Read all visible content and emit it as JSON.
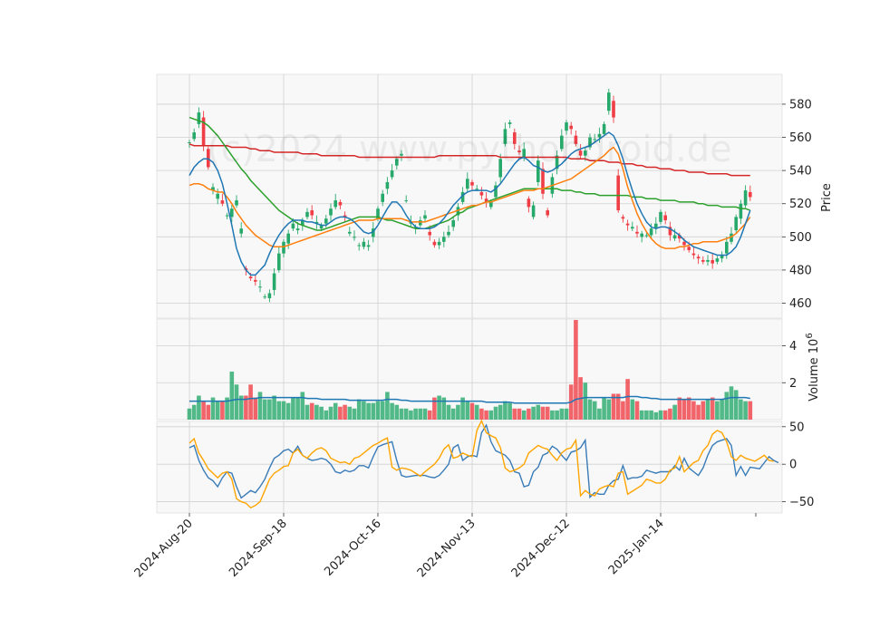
{
  "chart_data": {
    "type": "candlestick",
    "watermark": "(c)2024 www.pythondroid.de",
    "x_ticks": [
      "2024-Aug-20",
      "2024-Sep-18",
      "2024-Oct-16",
      "2024-Nov-13",
      "2024-Dec-12",
      "2025-Jan-14"
    ],
    "x_tick_index": [
      0,
      20,
      40,
      60,
      80,
      100
    ],
    "n_bars": 120,
    "colors": {
      "up": "#26a96a",
      "down": "#ef3e45",
      "ma_short": "#1f77b4",
      "ma_mid": "#ff7f0e",
      "ma_long": "#2ca02c",
      "ma_200": "#d62728",
      "osc_1": "#3a7cb8",
      "osc_2": "#ffa500"
    },
    "price_panel": {
      "ylabel": "Price",
      "yticks": [
        460,
        480,
        500,
        520,
        540,
        560,
        580
      ],
      "ylim": [
        451,
        598
      ],
      "close": [
        557,
        563,
        575,
        555,
        542,
        530,
        526,
        520,
        513,
        517,
        522,
        505,
        480,
        475,
        473,
        470,
        464,
        466,
        478,
        490,
        497,
        502,
        508,
        505,
        510,
        515,
        513,
        509,
        507,
        511,
        517,
        522,
        519,
        512,
        503,
        500,
        495,
        497,
        495,
        505,
        517,
        526,
        533,
        540,
        547,
        550,
        522,
        509,
        506,
        510,
        513,
        501,
        495,
        497,
        500,
        503,
        510,
        518,
        527,
        535,
        531,
        529,
        525,
        521,
        521,
        531,
        547,
        565,
        569,
        556,
        551,
        553,
        518,
        519,
        546,
        526,
        513,
        536,
        549,
        561,
        569,
        565,
        556,
        549,
        552,
        560,
        559,
        562,
        568,
        587,
        572,
        516,
        511,
        507,
        506,
        502,
        502,
        501,
        505,
        508,
        515,
        510,
        501,
        501,
        499,
        495,
        492,
        489,
        487,
        485,
        486,
        484,
        487,
        489,
        497,
        502,
        512,
        520,
        528,
        524
      ],
      "open": [
        557,
        559,
        568,
        572,
        553,
        528,
        523,
        522,
        513,
        512,
        519,
        502,
        481,
        476,
        474,
        470,
        464,
        463,
        468,
        480,
        490,
        496,
        505,
        504,
        507,
        512,
        516,
        508,
        505,
        508,
        513,
        518,
        521,
        513,
        502,
        500,
        495,
        494,
        494,
        500,
        511,
        521,
        529,
        536,
        543,
        549,
        522,
        508,
        505,
        507,
        511,
        503,
        497,
        495,
        497,
        501,
        506,
        513,
        521,
        529,
        533,
        529,
        527,
        523,
        518,
        524,
        536,
        556,
        568,
        563,
        552,
        548,
        523,
        512,
        533,
        541,
        516,
        526,
        541,
        553,
        564,
        567,
        561,
        552,
        549,
        554,
        559,
        560,
        562,
        576,
        582,
        537,
        512,
        508,
        505,
        503,
        500,
        501,
        501,
        505,
        509,
        513,
        506,
        499,
        501,
        497,
        494,
        490,
        488,
        486,
        485,
        486,
        485,
        487,
        490,
        497,
        504,
        511,
        519,
        527
      ],
      "ma_short": [
        537,
        542,
        545,
        547,
        547,
        545,
        540,
        532,
        520,
        507,
        493,
        485,
        480,
        477,
        477,
        480,
        483,
        490,
        496,
        501,
        505,
        508,
        510,
        510,
        510,
        509,
        509,
        508,
        507,
        507,
        509,
        511,
        512,
        512,
        511,
        509,
        506,
        503,
        502,
        503,
        507,
        512,
        517,
        521,
        521,
        518,
        513,
        509,
        506,
        505,
        505,
        505,
        506,
        508,
        511,
        515,
        519,
        522,
        525,
        527,
        528,
        528,
        528,
        528,
        527,
        529,
        532,
        536,
        540,
        544,
        547,
        548,
        546,
        543,
        542,
        540,
        539,
        540,
        542,
        544,
        547,
        550,
        552,
        553,
        554,
        555,
        557,
        559,
        561,
        563,
        561,
        555,
        547,
        537,
        528,
        520,
        514,
        509,
        506,
        505,
        506,
        506,
        505,
        503,
        501,
        498,
        496,
        494,
        493,
        492,
        491,
        490,
        489,
        489,
        489,
        491,
        494,
        500,
        508,
        516
      ],
      "ma_mid": [
        531,
        532,
        532,
        531,
        529,
        528,
        527,
        527,
        524,
        520,
        515,
        511,
        507,
        504,
        501,
        499,
        497,
        495,
        494,
        494,
        494,
        495,
        496,
        497,
        498,
        499,
        500,
        501,
        502,
        503,
        504,
        505,
        506,
        507,
        508,
        509,
        510,
        510,
        510,
        510,
        511,
        511,
        511,
        511,
        511,
        511,
        510,
        509,
        509,
        509,
        509,
        510,
        511,
        512,
        513,
        514,
        515,
        516,
        517,
        518,
        519,
        519,
        520,
        521,
        521,
        522,
        523,
        524,
        525,
        526,
        527,
        528,
        528,
        528,
        529,
        529,
        530,
        531,
        532,
        533,
        534,
        535,
        537,
        539,
        541,
        543,
        545,
        547,
        549,
        552,
        554,
        550,
        541,
        530,
        522,
        514,
        508,
        503,
        499,
        496,
        494,
        493,
        493,
        493,
        494,
        494,
        495,
        496,
        496,
        497,
        497,
        497,
        497,
        498,
        499,
        500,
        502,
        505,
        508,
        512
      ],
      "ma_long": [
        572,
        571,
        570,
        569,
        567,
        564,
        561,
        557,
        553,
        549,
        545,
        541,
        538,
        534,
        531,
        528,
        525,
        522,
        519,
        516,
        514,
        512,
        510,
        508,
        507,
        506,
        505,
        504,
        504,
        505,
        506,
        507,
        508,
        509,
        510,
        511,
        512,
        512,
        512,
        512,
        512,
        511,
        510,
        510,
        509,
        508,
        507,
        506,
        505,
        505,
        505,
        506,
        507,
        508,
        509,
        510,
        512,
        514,
        515,
        517,
        518,
        519,
        520,
        521,
        522,
        523,
        524,
        525,
        526,
        527,
        528,
        529,
        529,
        529,
        529,
        529,
        529,
        529,
        529,
        528,
        528,
        528,
        527,
        527,
        526,
        526,
        526,
        525,
        525,
        525,
        525,
        525,
        525,
        525,
        524,
        524,
        524,
        523,
        523,
        523,
        522,
        522,
        522,
        522,
        521,
        521,
        521,
        521,
        520,
        520,
        519,
        519,
        519,
        518,
        518,
        518,
        518,
        517,
        517,
        516
      ],
      "ma_200": [
        556,
        555,
        555,
        555,
        555,
        555,
        555,
        555,
        555,
        554,
        554,
        554,
        554,
        553,
        553,
        552,
        552,
        552,
        551,
        551,
        551,
        551,
        551,
        551,
        550,
        550,
        550,
        550,
        549,
        549,
        549,
        549,
        549,
        549,
        549,
        549,
        548,
        548,
        548,
        548,
        548,
        548,
        548,
        548,
        548,
        548,
        548,
        548,
        548,
        548,
        548,
        548,
        548,
        549,
        549,
        549,
        549,
        549,
        549,
        549,
        549,
        549,
        549,
        549,
        549,
        549,
        548,
        548,
        548,
        548,
        548,
        548,
        548,
        548,
        548,
        548,
        548,
        548,
        548,
        548,
        548,
        547,
        547,
        547,
        547,
        546,
        546,
        546,
        546,
        545,
        545,
        545,
        544,
        544,
        544,
        543,
        543,
        542,
        542,
        542,
        541,
        541,
        541,
        540,
        540,
        540,
        539,
        539,
        539,
        539,
        538,
        538,
        538,
        538,
        538,
        537,
        537,
        537,
        537,
        537
      ]
    },
    "volume_panel": {
      "ylabel": "Volume  10",
      "ylabel_exp": "6",
      "yticks": [
        2,
        4
      ],
      "ylim": [
        0,
        5.45
      ],
      "volume": [
        0.6,
        0.8,
        1.3,
        1.0,
        0.8,
        1.2,
        1.0,
        1.0,
        1.2,
        2.6,
        1.9,
        1.3,
        1.3,
        1.9,
        1.2,
        1.5,
        1.1,
        1.1,
        1.3,
        1.0,
        1.0,
        0.9,
        1.2,
        1.2,
        1.5,
        0.8,
        0.9,
        0.8,
        0.7,
        0.5,
        0.7,
        0.9,
        0.7,
        0.8,
        0.7,
        0.6,
        1.1,
        1.0,
        0.9,
        0.9,
        1.0,
        1.0,
        1.5,
        0.9,
        0.8,
        0.6,
        0.6,
        0.5,
        0.6,
        0.6,
        0.6,
        0.5,
        1.2,
        1.3,
        1.2,
        0.8,
        0.6,
        0.8,
        1.2,
        1.0,
        0.9,
        0.8,
        0.6,
        0.5,
        0.5,
        0.7,
        0.8,
        1.0,
        0.9,
        0.6,
        0.6,
        0.5,
        0.6,
        0.7,
        0.8,
        0.7,
        0.7,
        0.5,
        0.5,
        0.6,
        0.6,
        1.9,
        5.4,
        2.3,
        2.0,
        1.1,
        1.0,
        0.6,
        1.2,
        1.1,
        1.4,
        1.4,
        1.0,
        2.2,
        1.1,
        1.0,
        0.5,
        0.5,
        0.5,
        0.4,
        0.5,
        0.5,
        0.6,
        0.8,
        1.2,
        1.1,
        1.2,
        1.0,
        0.8,
        1.0,
        1.1,
        1.2,
        1.0,
        1.1,
        1.5,
        1.8,
        1.6,
        1.1,
        1.0,
        1.0
      ],
      "volume_ma": [
        1.0,
        1.0,
        1.0,
        1.0,
        1.0,
        1.0,
        1.0,
        1.0,
        1.0,
        1.05,
        1.1,
        1.1,
        1.1,
        1.15,
        1.15,
        1.2,
        1.2,
        1.2,
        1.2,
        1.2,
        1.2,
        1.2,
        1.2,
        1.2,
        1.2,
        1.15,
        1.15,
        1.15,
        1.1,
        1.1,
        1.1,
        1.1,
        1.1,
        1.1,
        1.05,
        1.05,
        1.05,
        1.05,
        1.05,
        1.05,
        1.05,
        1.05,
        1.1,
        1.1,
        1.1,
        1.05,
        1.05,
        1.0,
        1.0,
        1.0,
        1.0,
        1.0,
        1.0,
        1.0,
        1.0,
        1.0,
        1.0,
        1.0,
        1.0,
        1.0,
        1.0,
        1.0,
        1.0,
        0.95,
        0.95,
        0.95,
        0.95,
        0.95,
        0.95,
        0.9,
        0.9,
        0.9,
        0.9,
        0.9,
        0.9,
        0.9,
        0.9,
        0.9,
        0.9,
        0.9,
        0.9,
        0.95,
        1.1,
        1.15,
        1.2,
        1.2,
        1.2,
        1.2,
        1.2,
        1.2,
        1.2,
        1.2,
        1.2,
        1.25,
        1.25,
        1.25,
        1.2,
        1.2,
        1.15,
        1.15,
        1.1,
        1.1,
        1.1,
        1.1,
        1.1,
        1.1,
        1.1,
        1.1,
        1.1,
        1.1,
        1.1,
        1.1,
        1.1,
        1.1,
        1.15,
        1.2,
        1.2,
        1.2,
        1.2,
        1.15
      ]
    },
    "oscillator_panel": {
      "yticks": [
        -50,
        0,
        50
      ],
      "ylim": [
        -65,
        57
      ],
      "line1": [
        22,
        25,
        5,
        -8,
        -18,
        -22,
        -30,
        -18,
        -10,
        -12,
        -30,
        -45,
        -40,
        -35,
        -38,
        -30,
        -20,
        -5,
        8,
        12,
        18,
        20,
        15,
        24,
        12,
        8,
        5,
        6,
        8,
        6,
        0,
        -10,
        -12,
        -8,
        -10,
        -8,
        -2,
        -2,
        -5,
        10,
        23,
        26,
        28,
        30,
        5,
        -15,
        -17,
        -16,
        -15,
        -15,
        -15,
        -17,
        -18,
        -15,
        -8,
        0,
        22,
        26,
        5,
        10,
        12,
        10,
        42,
        52,
        30,
        18,
        15,
        12,
        5,
        -10,
        -12,
        -30,
        -28,
        -10,
        -4,
        12,
        15,
        24,
        20,
        12,
        5,
        16,
        18,
        22,
        32,
        -44,
        -38,
        -40,
        -40,
        -28,
        -22,
        -20,
        -2,
        -20,
        -18,
        -18,
        -16,
        -8,
        -10,
        -12,
        -10,
        -10,
        -10,
        -2,
        -8,
        8,
        -5,
        -10,
        -15,
        -5,
        12,
        25,
        30,
        32,
        34,
        25,
        -15,
        -3,
        -15,
        -4,
        -5,
        -6,
        2,
        10,
        5,
        2
      ],
      "line2": [
        28,
        34,
        15,
        5,
        -6,
        -12,
        -18,
        -12,
        -10,
        -20,
        -46,
        -50,
        -52,
        -58,
        -55,
        -50,
        -35,
        -20,
        -12,
        -8,
        -3,
        -2,
        15,
        20,
        12,
        8,
        15,
        20,
        22,
        18,
        8,
        5,
        2,
        3,
        0,
        8,
        10,
        15,
        20,
        25,
        28,
        32,
        35,
        -4,
        -8,
        -5,
        -6,
        -8,
        -12,
        -16,
        -10,
        -5,
        0,
        8,
        20,
        26,
        8,
        10,
        15,
        12,
        10,
        45,
        58,
        42,
        38,
        35,
        22,
        -5,
        -10,
        -8,
        -5,
        0,
        15,
        20,
        25,
        22,
        20,
        12,
        5,
        15,
        20,
        22,
        32,
        -42,
        -35,
        -40,
        -42,
        -33,
        -30,
        -28,
        -30,
        -12,
        -10,
        -40,
        -36,
        -32,
        -28,
        -20,
        -22,
        -25,
        -25,
        -20,
        -8,
        -5,
        10,
        -10,
        -4,
        2,
        5,
        18,
        25,
        40,
        45,
        42,
        30,
        10,
        5,
        12,
        8,
        6,
        4,
        8,
        12,
        5,
        4
      ]
    }
  }
}
